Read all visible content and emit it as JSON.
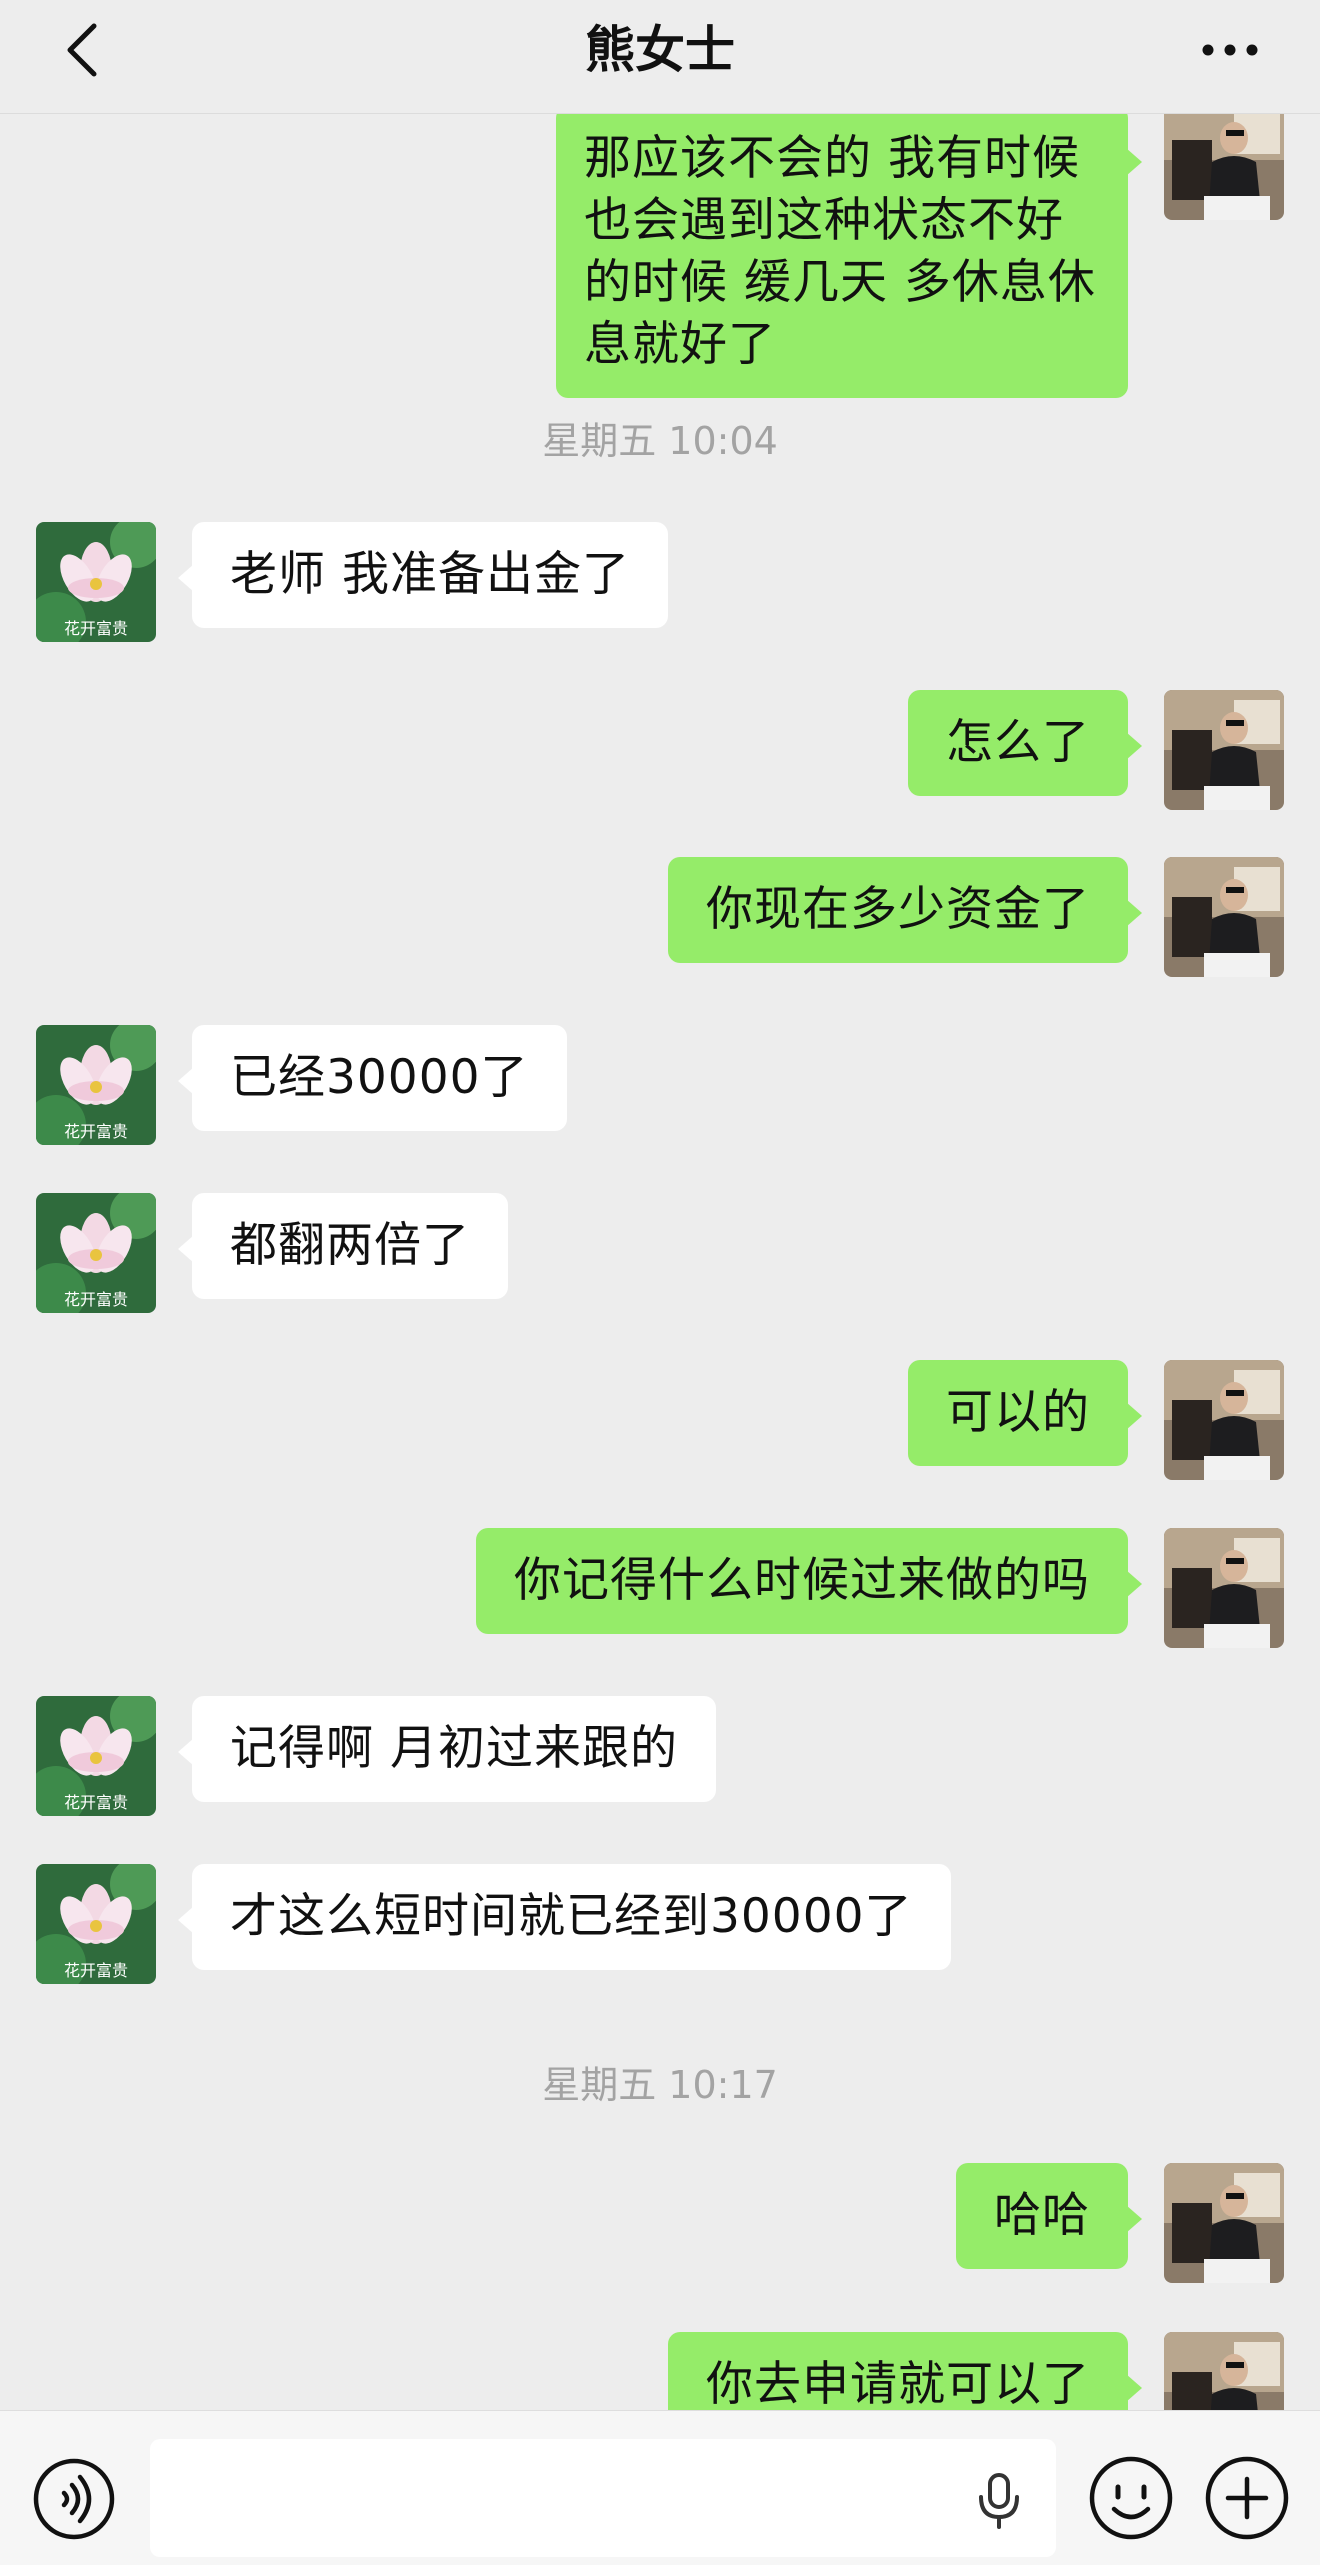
{
  "header": {
    "title": "熊女士"
  },
  "messages": [
    {
      "type": "message",
      "side": "out",
      "text": "那应该不会的 我有时候也会遇到这种状态不好的时候 缓几天 多休息休息就好了"
    },
    {
      "type": "timestamp",
      "text": "星期五 10:04"
    },
    {
      "type": "message",
      "side": "in",
      "text": "老师 我准备出金了"
    },
    {
      "type": "message",
      "side": "out",
      "text": "怎么了"
    },
    {
      "type": "message",
      "side": "out",
      "text": "你现在多少资金了"
    },
    {
      "type": "message",
      "side": "in",
      "text": "已经30000了"
    },
    {
      "type": "message",
      "side": "in",
      "text": "都翻两倍了"
    },
    {
      "type": "message",
      "side": "out",
      "text": "可以的"
    },
    {
      "type": "message",
      "side": "out",
      "text": "你记得什么时候过来做的吗"
    },
    {
      "type": "message",
      "side": "in",
      "text": "记得啊 月初过来跟的"
    },
    {
      "type": "message",
      "side": "in",
      "text": "才这么短时间就已经到30000了"
    },
    {
      "type": "timestamp",
      "text": "星期五 10:17"
    },
    {
      "type": "message",
      "side": "out",
      "text": "哈哈"
    },
    {
      "type": "message",
      "side": "out",
      "text": "你去申请就可以了"
    }
  ],
  "contact_avatar": {
    "caption": "花开富贵",
    "icon": "lotus-flower-avatar"
  },
  "self_avatar": {
    "icon": "man-seated-photo-avatar"
  },
  "input_bar": {
    "placeholder": "",
    "icons": [
      "voice-icon",
      "mic-icon",
      "emoji-icon",
      "plus-icon"
    ]
  },
  "colors": {
    "background": "#ededed",
    "outgoing_bubble": "#95ec69",
    "incoming_bubble": "#ffffff",
    "timestamp": "#a3a3a3"
  }
}
